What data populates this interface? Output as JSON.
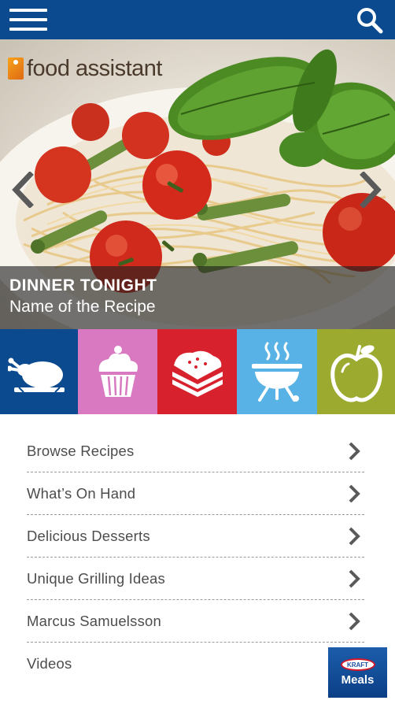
{
  "header": {
    "menu_icon": "hamburger-menu-icon",
    "search_icon": "search-icon",
    "background_color": "#0b4a8e"
  },
  "hero": {
    "logo_text": "food assistant",
    "section_title": "DINNER TONIGHT",
    "recipe_name": "Name of the Recipe",
    "prev_icon": "chevron-left-icon",
    "next_icon": "chevron-right-icon"
  },
  "categories": [
    {
      "icon": "roast-chicken-icon",
      "color": "#0b4a8e"
    },
    {
      "icon": "cupcake-icon",
      "color": "#d879c2"
    },
    {
      "icon": "sandwich-icon",
      "color": "#d7222e"
    },
    {
      "icon": "grill-icon",
      "color": "#58b2e6"
    },
    {
      "icon": "apple-icon",
      "color": "#9caa2f"
    }
  ],
  "menu": {
    "items": [
      {
        "label": "Browse Recipes"
      },
      {
        "label": "What’s On Hand"
      },
      {
        "label": "Delicious Desserts"
      },
      {
        "label": "Unique Grilling Ideas"
      },
      {
        "label": "Marcus Samuelsson"
      },
      {
        "label": "Videos"
      }
    ]
  },
  "sponsor": {
    "brand": "KRAFT",
    "name": "Meals"
  }
}
